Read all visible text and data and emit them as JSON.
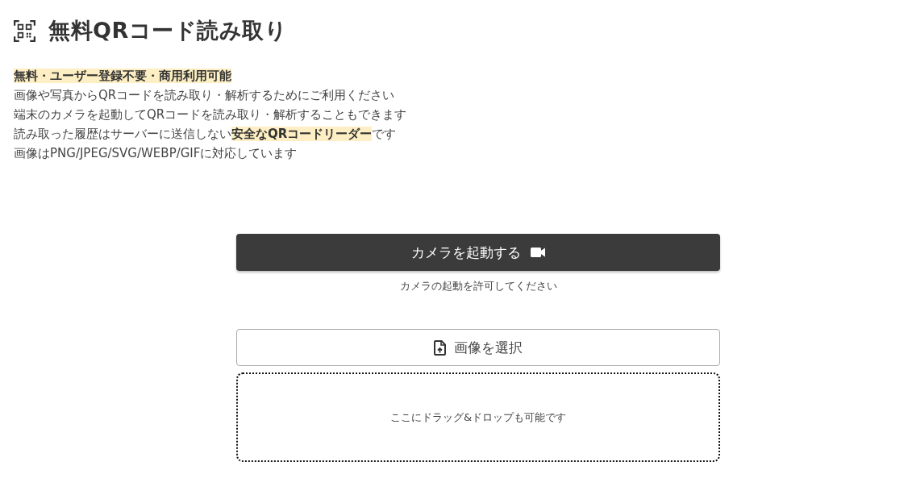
{
  "header": {
    "title": "無料QRコード読み取り"
  },
  "intro": {
    "lines": [
      "**無料・ユーザー登録不要・商用利用可能**",
      "画像や写真からQRコードを読み取り・解析するためにご利用ください",
      "端末のカメラを起動してQRコードを読み取り・解析することもできます",
      "読み取った履歴はサーバーに送信しない**安全なQRコードリーダー**です",
      "画像はPNG/JPEG/SVG/WEBP/GIFに対応しています"
    ]
  },
  "camera": {
    "button": "カメラを起動する",
    "note": "カメラの起動を許可してください"
  },
  "upload": {
    "button": "画像を選択",
    "dropzone": "ここにドラッグ&ドロップも可能です"
  }
}
